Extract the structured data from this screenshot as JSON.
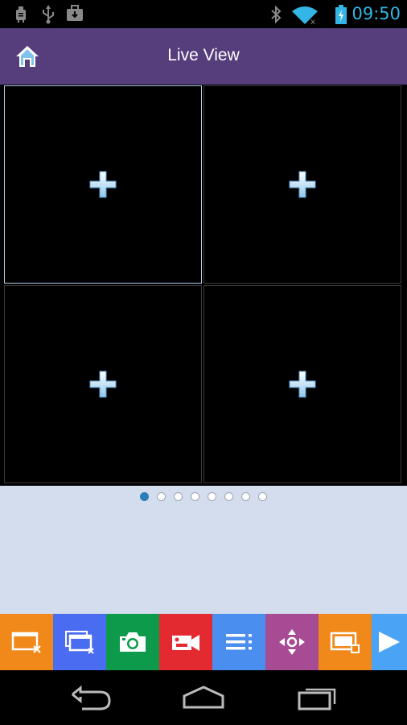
{
  "status_bar": {
    "time": "09:50",
    "left_icons": [
      "android-debug-icon",
      "usb-icon",
      "briefcase-icon"
    ],
    "right_icons": [
      "bluetooth-icon",
      "wifi-icon",
      "battery-charging-icon"
    ]
  },
  "header": {
    "title": "Live View",
    "home_icon": "home-icon"
  },
  "grid": {
    "cells": [
      {
        "icon": "add-camera-plus-icon",
        "selected": true
      },
      {
        "icon": "add-camera-plus-icon",
        "selected": false
      },
      {
        "icon": "add-camera-plus-icon",
        "selected": false
      },
      {
        "icon": "add-camera-plus-icon",
        "selected": false
      }
    ]
  },
  "pager": {
    "total_pages": 8,
    "active_page": 1
  },
  "toolbar": {
    "buttons": [
      {
        "icon": "close-window-icon",
        "color": "#f0891a"
      },
      {
        "icon": "close-all-windows-icon",
        "color": "#4a6cf0"
      },
      {
        "icon": "camera-snapshot-icon",
        "color": "#0d9b4b"
      },
      {
        "icon": "video-record-icon",
        "color": "#e42a31"
      },
      {
        "icon": "menu-list-icon",
        "color": "#4a8ef0"
      },
      {
        "icon": "ptz-control-icon",
        "color": "#a74b95"
      },
      {
        "icon": "window-settings-icon",
        "color": "#f0891a"
      },
      {
        "icon": "play-next-icon",
        "color": "#4aa3f5"
      }
    ]
  },
  "nav_bar": {
    "icons": [
      "back-icon",
      "home-nav-icon",
      "recent-apps-icon"
    ]
  },
  "colors": {
    "header_bg": "#563d7c",
    "clock": "#33b5e5",
    "pager_bg": "#d3ddee",
    "selected_border": "#aecbe6"
  }
}
